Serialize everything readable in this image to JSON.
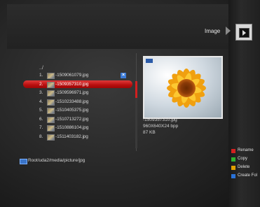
{
  "header": {
    "title": "Image"
  },
  "browser": {
    "parent_dir": "../",
    "files": [
      {
        "num": "1.",
        "name": "-1509061079.jpg"
      },
      {
        "num": "2.",
        "name": "-1509357310.jpg"
      },
      {
        "num": "3.",
        "name": "-1509596971.jpg"
      },
      {
        "num": "4.",
        "name": "-1510233488.jpg"
      },
      {
        "num": "5.",
        "name": "-1510405375.jpg"
      },
      {
        "num": "6.",
        "name": "-1510713272.jpg"
      },
      {
        "num": "7.",
        "name": "-1510886104.jpg"
      },
      {
        "num": "8.",
        "name": "-1511403182.jpg"
      }
    ],
    "selected_index": 1,
    "path": "Root/uda2/media/picture/jpg"
  },
  "preview": {
    "file_name": "-1509357310.jpg",
    "dimensions": "960X640X24 bpp",
    "size": "87 KB"
  },
  "color_keys": [
    {
      "label": "Rename",
      "color": "#d42020"
    },
    {
      "label": "Copy",
      "color": "#2fb02f"
    },
    {
      "label": "Delete",
      "color": "#e0a000"
    },
    {
      "label": "Create Fol",
      "color": "#2a72d8"
    }
  ]
}
